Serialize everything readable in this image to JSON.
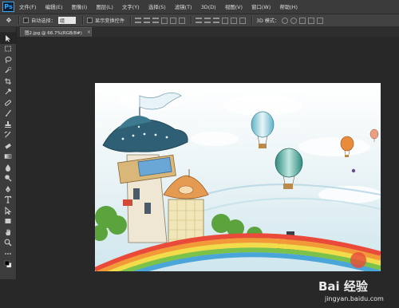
{
  "app": {
    "logo_text": "Ps",
    "menu": [
      "文件(F)",
      "编辑(E)",
      "图像(I)",
      "图层(L)",
      "文字(Y)",
      "选择(S)",
      "滤镜(T)",
      "3D(D)",
      "视图(V)",
      "窗口(W)",
      "帮助(H)"
    ]
  },
  "options": {
    "auto_select_label": "自动选择：",
    "auto_select_value": "组",
    "show_transform_label": "显示变换控件",
    "mode_3d_label": "3D 模式："
  },
  "tools": [
    "move-tool",
    "marquee-tool",
    "lasso-tool",
    "quick-select-tool",
    "crop-tool",
    "eyedropper-tool",
    "healing-tool",
    "brush-tool",
    "clone-stamp-tool",
    "history-brush-tool",
    "eraser-tool",
    "gradient-tool",
    "blur-tool",
    "dodge-tool",
    "pen-tool",
    "type-tool",
    "path-select-tool",
    "shape-tool",
    "hand-tool",
    "zoom-tool",
    "more-tool",
    "color-swatch"
  ],
  "document": {
    "tab_title": "图2.jpg @ 66.7%(RGB/8#)",
    "close_glyph": "×"
  },
  "watermark": {
    "brand": "Bai 经验",
    "url": "jingyan.baidu.com"
  },
  "colors": {
    "app_bg": "#282828",
    "menubar_bg": "#3b3b3b",
    "ps_blue": "#31a8ff"
  }
}
